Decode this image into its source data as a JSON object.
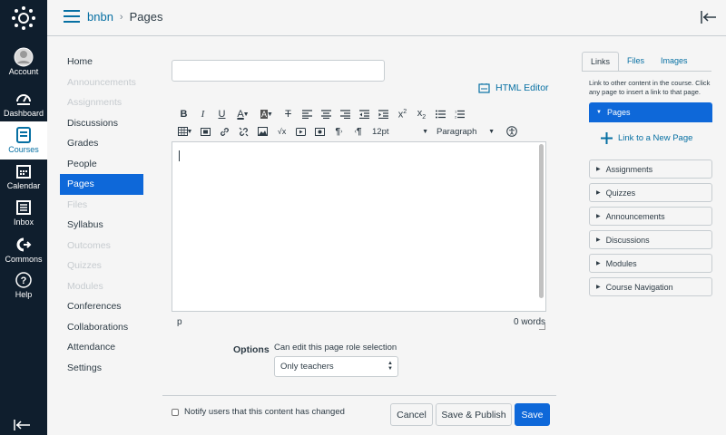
{
  "global_nav": {
    "items": [
      {
        "label": "Account",
        "icon": "account-icon"
      },
      {
        "label": "Dashboard",
        "icon": "dashboard-icon"
      },
      {
        "label": "Courses",
        "icon": "courses-icon"
      },
      {
        "label": "Calendar",
        "icon": "calendar-icon"
      },
      {
        "label": "Inbox",
        "icon": "inbox-icon"
      },
      {
        "label": "Commons",
        "icon": "commons-icon"
      },
      {
        "label": "Help",
        "icon": "help-icon"
      }
    ],
    "active": "Courses"
  },
  "header": {
    "course": "bnbn",
    "separator": "›",
    "page": "Pages"
  },
  "course_nav": {
    "items": [
      {
        "label": "Home",
        "state": "normal"
      },
      {
        "label": "Announcements",
        "state": "disabled"
      },
      {
        "label": "Assignments",
        "state": "disabled"
      },
      {
        "label": "Discussions",
        "state": "normal"
      },
      {
        "label": "Grades",
        "state": "normal"
      },
      {
        "label": "People",
        "state": "normal"
      },
      {
        "label": "Pages",
        "state": "active"
      },
      {
        "label": "Files",
        "state": "disabled"
      },
      {
        "label": "Syllabus",
        "state": "normal"
      },
      {
        "label": "Outcomes",
        "state": "disabled"
      },
      {
        "label": "Quizzes",
        "state": "disabled"
      },
      {
        "label": "Modules",
        "state": "disabled"
      },
      {
        "label": "Conferences",
        "state": "normal"
      },
      {
        "label": "Collaborations",
        "state": "normal"
      },
      {
        "label": "Attendance",
        "state": "normal"
      },
      {
        "label": "Settings",
        "state": "normal"
      }
    ]
  },
  "editor": {
    "title_value": "",
    "html_editor_label": "HTML Editor",
    "font_size": "12pt",
    "block_format": "Paragraph",
    "status_path": "p",
    "word_count": "0 words"
  },
  "options": {
    "label": "Options",
    "description": "Can edit this page role selection",
    "selected": "Only teachers"
  },
  "footer": {
    "notify_label": "Notify users that this content has changed",
    "cancel": "Cancel",
    "save_publish": "Save & Publish",
    "save": "Save"
  },
  "sidebar": {
    "tabs": [
      "Links",
      "Files",
      "Images"
    ],
    "active_tab": "Links",
    "description": "Link to other content in the course. Click any page to insert a link to that page.",
    "active_section": "Pages",
    "new_link": "Link to a New Page",
    "sections": [
      "Assignments",
      "Quizzes",
      "Announcements",
      "Discussions",
      "Modules",
      "Course Navigation"
    ]
  },
  "colors": {
    "nav_bg": "#0f1e2d",
    "link": "#0770a3",
    "primary": "#0e68d9"
  }
}
